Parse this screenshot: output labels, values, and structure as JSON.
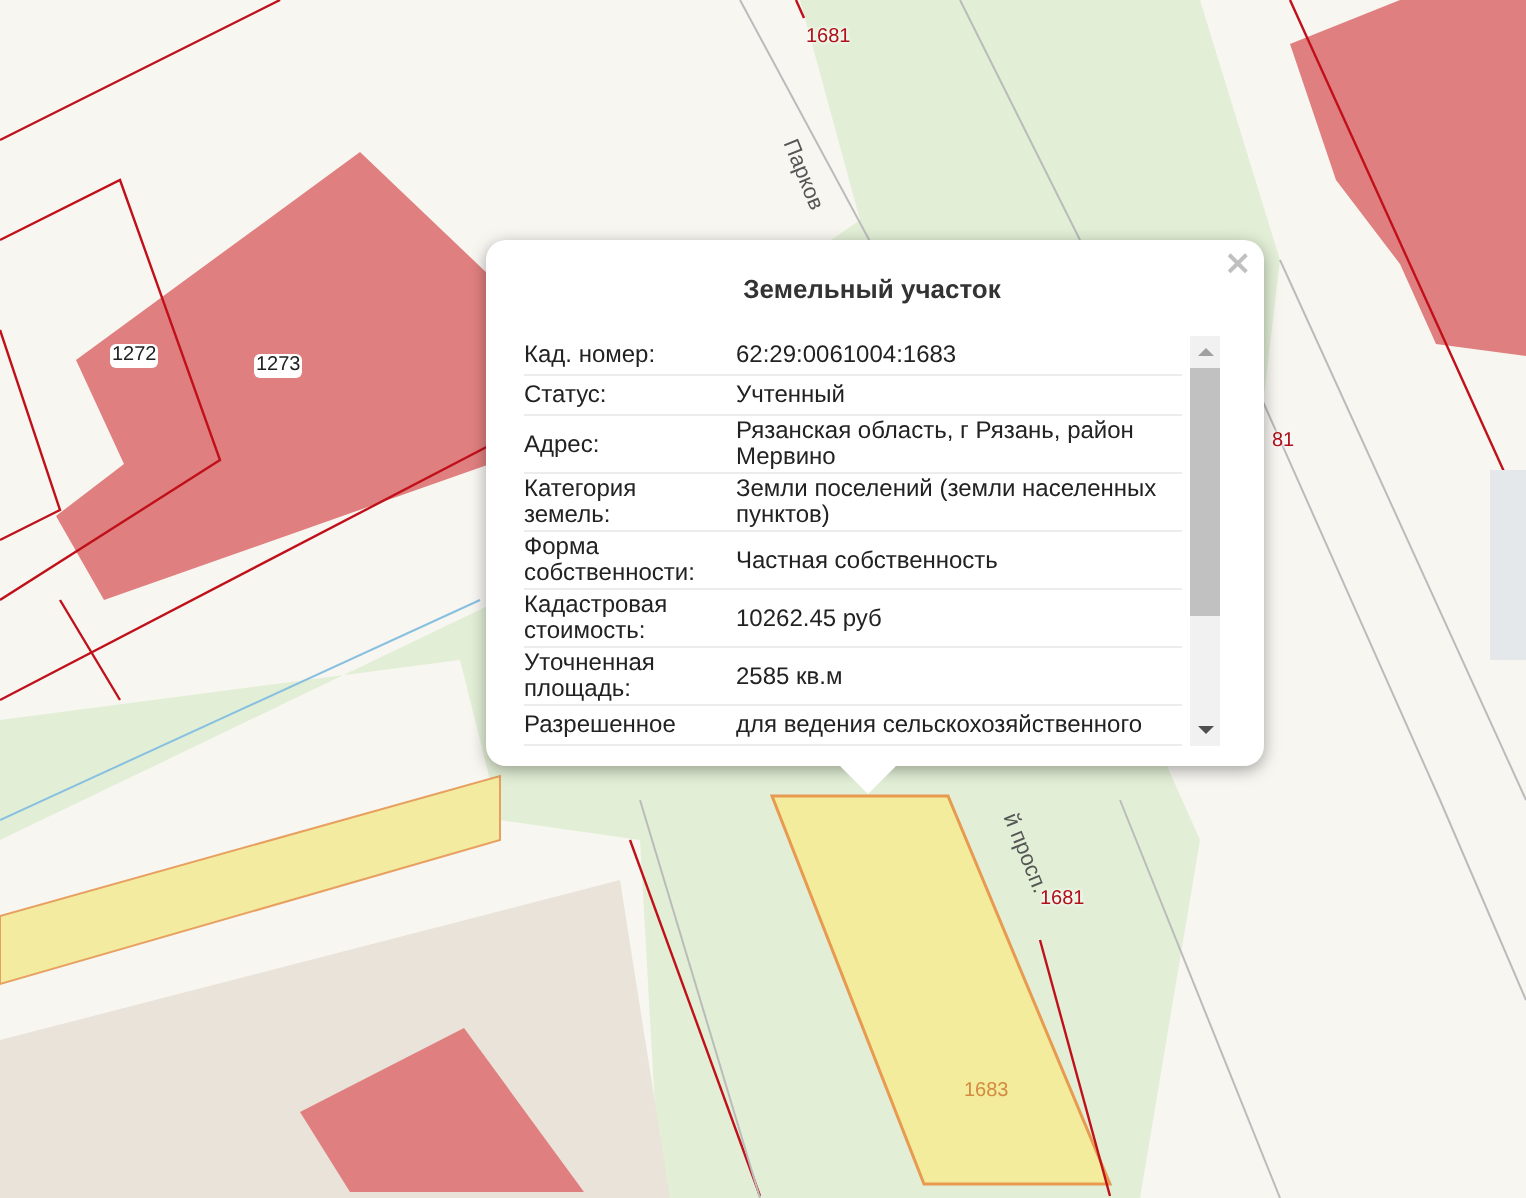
{
  "map_labels": [
    {
      "kind": "parcel",
      "text": "1681"
    },
    {
      "kind": "building",
      "text": "1272"
    },
    {
      "kind": "building",
      "text": "1273"
    },
    {
      "kind": "street",
      "text": "Парков"
    },
    {
      "kind": "parcel",
      "text": "81"
    },
    {
      "kind": "street",
      "text": "й просп."
    },
    {
      "kind": "parcel",
      "text": "1681"
    },
    {
      "kind": "selected_parcel",
      "text": "1683"
    }
  ],
  "popup": {
    "title": "Земельный участок",
    "close": "×",
    "fields": [
      {
        "label": "Кад. номер:",
        "value": "62:29:0061004:1683"
      },
      {
        "label": "Статус:",
        "value": "Учтенный"
      },
      {
        "label": "Адрес:",
        "value": "Рязанская область, г Рязань, район Мервино"
      },
      {
        "label": "Категория земель:",
        "value": "Земли поселений (земли населенных пунктов)"
      },
      {
        "label": "Форма собственности:",
        "value": "Частная собственность"
      },
      {
        "label": "Кадастровая стоимость:",
        "value": "10262.45 руб"
      },
      {
        "label": "Уточненная площадь:",
        "value": "2585 кв.м"
      },
      {
        "label": "Разрешенное",
        "value": "для ведения сельскохозяйственного"
      }
    ]
  }
}
